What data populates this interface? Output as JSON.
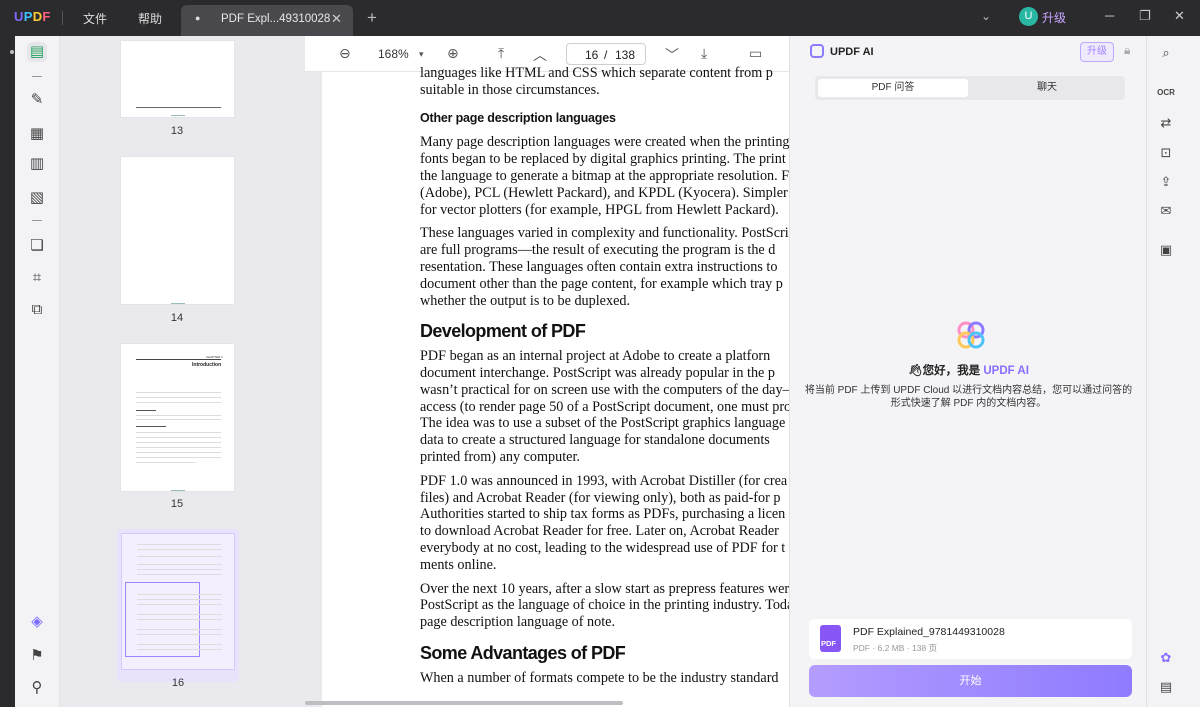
{
  "app": {
    "logo": {
      "u": "U",
      "p": "P",
      "d": "D",
      "f": "F"
    },
    "menu": [
      "文件",
      "帮助"
    ],
    "tab_title": "PDF Expl...49310028",
    "upgrade_label": "升级",
    "avatar_letter": "U"
  },
  "toolbar": {
    "zoom": "168%",
    "current_page": "16",
    "separator": "/",
    "total_pages": "138"
  },
  "thumbnails": [
    {
      "label": "13"
    },
    {
      "label": "14"
    },
    {
      "label": "15",
      "chapter": "CHAPTER 1",
      "chapter_title": "Introduction"
    },
    {
      "label": "16",
      "selected": true
    }
  ],
  "document": {
    "lines_top": "languages like HTML and CSS which separate content from p",
    "lines_top2": "suitable in those circumstances.",
    "h_other": "Other page description languages",
    "p1": [
      "Many page description languages were created when the printing",
      "fonts began to be replaced by digital graphics printing. The print",
      "the language to generate a bitmap at the appropriate resolution. Fo",
      "(Adobe), PCL (Hewlett Packard), and KPDL (Kyocera). Simpler",
      "for vector plotters (for example, HPGL from Hewlett Packard)."
    ],
    "p2": [
      "These languages varied in complexity and functionality. PostScrip",
      "are full programs—the result of executing the program is the d",
      "resentation. These languages often contain extra instructions to",
      "document other than the page content, for example which tray p",
      "whether the output is to be duplexed."
    ],
    "h_dev": "Development of PDF",
    "p3": [
      "PDF began as an internal project at Adobe to create a platforn",
      "document interchange. PostScript was already popular in the p",
      "wasn’t practical for on screen use with the computers of the day—",
      "access (to render page 50 of a PostScript document, one must pro",
      "The idea was to use a subset of the PostScript graphics language t",
      "data to create a structured language for standalone documents",
      "printed from) any computer."
    ],
    "p4": [
      "PDF 1.0 was announced in 1993, with Acrobat Distiller (for crea",
      "files) and Acrobat Reader (for viewing only), both as paid-for p",
      "Authorities started to ship tax forms as PDFs, purchasing a licen",
      "to download Acrobat Reader for free. Later on, Acrobat Reader ",
      "everybody at no cost, leading to the widespread use of PDF for t",
      "ments online."
    ],
    "p5": [
      "Over the next 10 years, after a slow start as prepress features were",
      "PostScript as the language of choice in the printing industry. Toda",
      "page description language of note."
    ],
    "h_adv": "Some Advantages of PDF",
    "lines_bottom": "When a number of formats compete to be the industry standard"
  },
  "ai": {
    "title": "UPDF AI",
    "upgrade": "升级",
    "tabs": [
      "PDF 问答",
      "聊天"
    ],
    "greeting_prefix": "您好，我是 ",
    "greeting_brand": "UPDF AI",
    "hint": "将当前 PDF 上传到 UPDF Cloud 以进行文档内容总结，您可以通过问答的形式快速了解 PDF 内的文档内容。",
    "file_name": "PDF Explained_9781449310028",
    "file_meta": "PDF · 6.2 MB · 138 页",
    "pdf_badge": "PDF",
    "start_button": "开始"
  },
  "colors": {
    "accent": "#8a6cff",
    "titlebar": "#2b2b2e",
    "active_icon": "#1da05a"
  }
}
